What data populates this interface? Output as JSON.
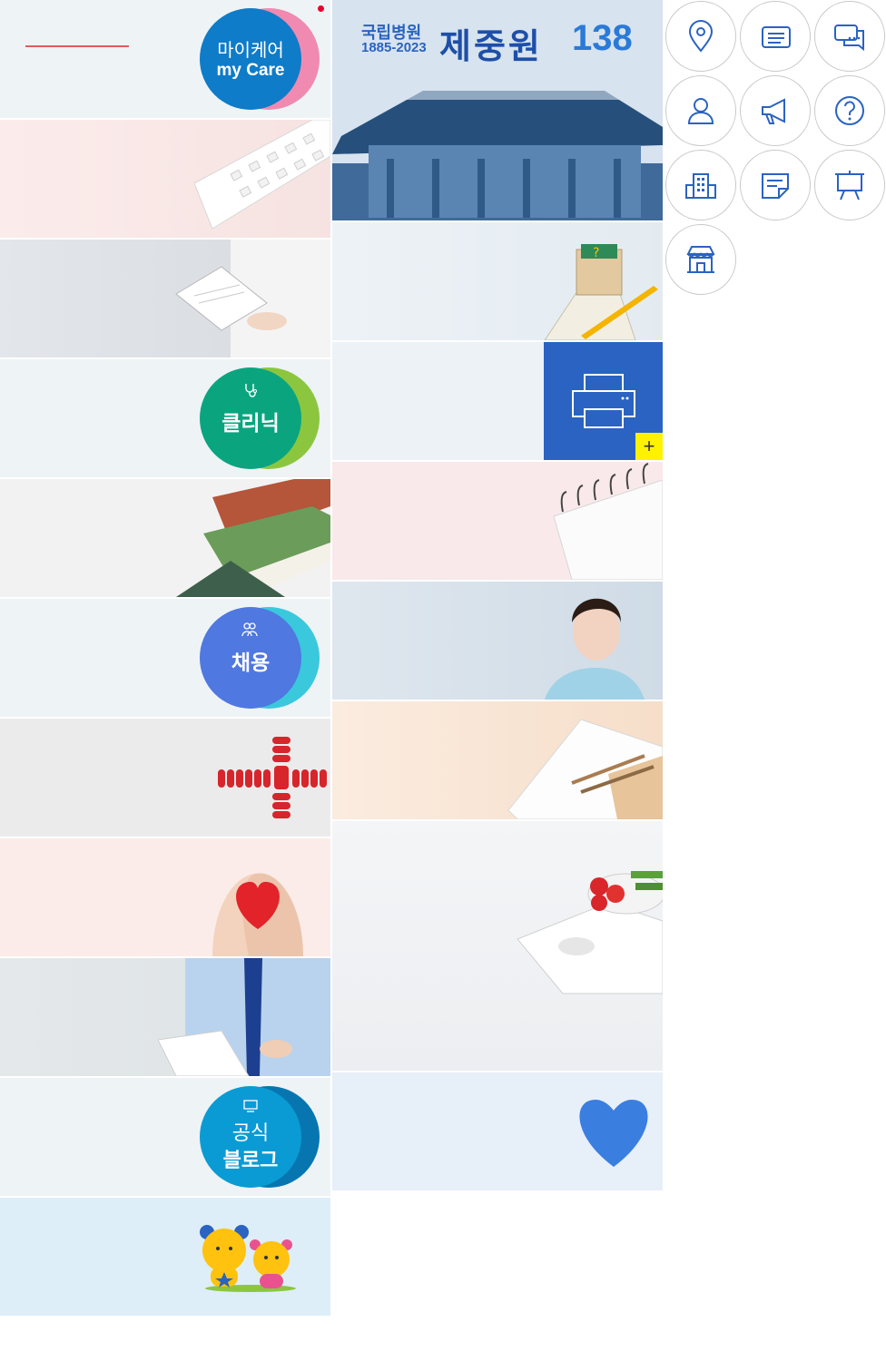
{
  "left_column": {
    "mycare": {
      "line1": "마이케어",
      "line2": "my Care",
      "colors": {
        "main": "#0e7cc8",
        "back": "#f08ab0",
        "dot": "#e8002a"
      }
    },
    "clinic": {
      "label": "클리닉",
      "icon": "stethoscope-icon",
      "colors": {
        "main": "#0aa57f",
        "back": "#8cc63f"
      }
    },
    "recruit": {
      "label": "채용",
      "icon": "people-icon",
      "colors": {
        "main": "#4f78e0",
        "back": "#3ac8dc"
      }
    },
    "blog": {
      "line1": "공식",
      "line2": "블로그",
      "icon": "monitor-icon",
      "colors": {
        "main": "#0a9bd4",
        "back": "#0776b0"
      }
    },
    "mascot": {
      "icon": "bear-mascots"
    }
  },
  "middle_column": {
    "banner": {
      "title_small": "국립병원",
      "years": "1885-2023",
      "title_big": "제중원",
      "number": "138"
    },
    "print_tile": {
      "icon": "printer-icon",
      "plus": "+",
      "colors": {
        "bg": "#2a63c1",
        "plus_bg": "#fff200"
      }
    }
  },
  "quick_icons": [
    {
      "name": "location-icon"
    },
    {
      "name": "document-icon"
    },
    {
      "name": "chat-icon"
    },
    {
      "name": "person-icon"
    },
    {
      "name": "megaphone-icon"
    },
    {
      "name": "question-icon"
    },
    {
      "name": "building-icon"
    },
    {
      "name": "memo-icon"
    },
    {
      "name": "presentation-icon"
    },
    {
      "name": "store-icon"
    }
  ],
  "colors": {
    "icon_stroke": "#2a63c1",
    "circle_border": "#c9c9c9"
  }
}
